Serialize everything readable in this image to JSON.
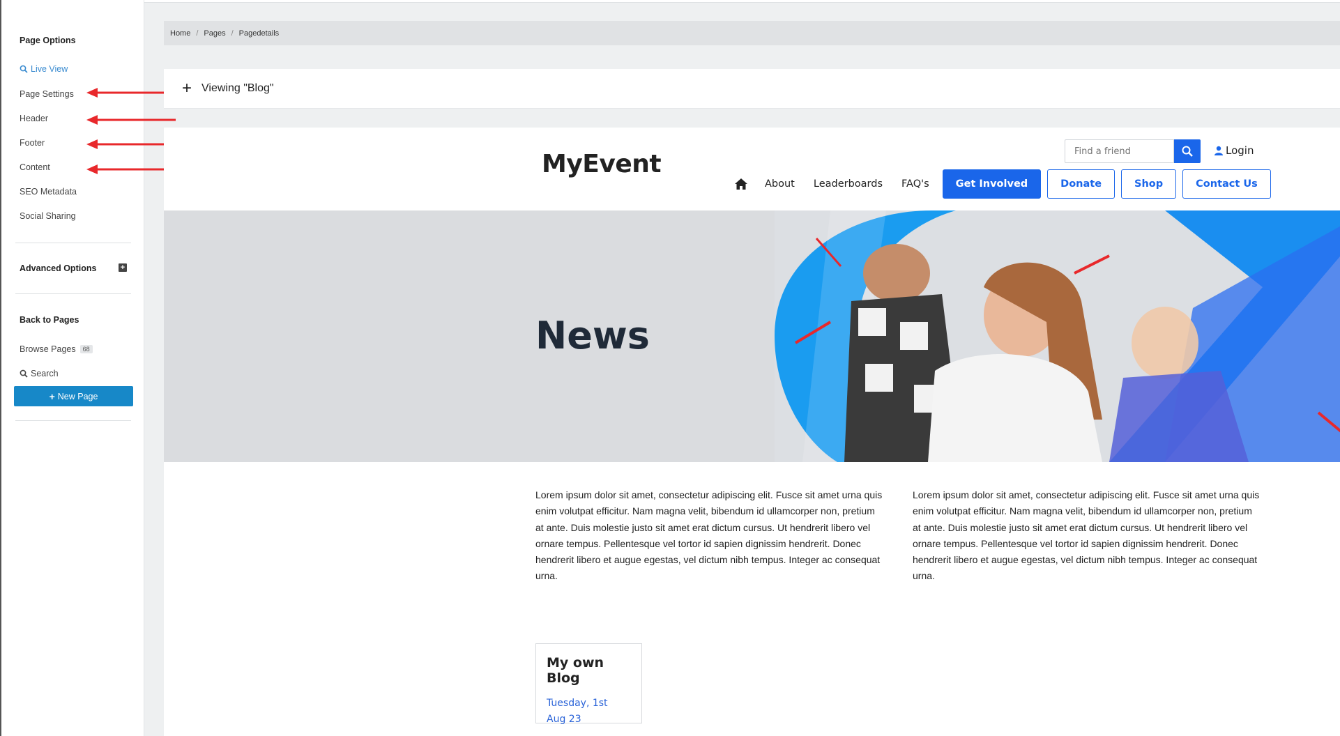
{
  "sidebar": {
    "page_options_title": "Page Options",
    "live_view": "Live View",
    "page_settings": "Page Settings",
    "header": "Header",
    "footer": "Footer",
    "content": "Content",
    "seo_metadata": "SEO Metadata",
    "social_sharing": "Social Sharing",
    "advanced_options": "Advanced Options",
    "back_to_pages": "Back to Pages",
    "browse_pages": "Browse Pages",
    "browse_pages_count": "68",
    "search": "Search",
    "new_page": "New Page"
  },
  "breadcrumb": [
    "Home",
    "Pages",
    "Pagedetails"
  ],
  "viewing": "Viewing \"Blog\"",
  "site": {
    "logo": "MyEvent",
    "search_placeholder": "Find a friend",
    "login": "Login",
    "nav_links": [
      "About",
      "Leaderboards",
      "FAQ's"
    ],
    "nav_buttons": [
      "Get Involved",
      "Donate",
      "Shop",
      "Contact Us"
    ],
    "hero_title": "News",
    "paragraph_1": "Lorem ipsum dolor sit amet, consectetur adipiscing elit. Fusce sit amet urna quis enim volutpat efficitur. Nam magna velit, bibendum id ullamcorper non, pretium at ante. Duis molestie justo sit amet erat dictum cursus. Ut hendrerit libero vel ornare tempus. Pellentesque vel tortor id sapien dignissim hendrerit. Donec hendrerit libero et augue egestas, vel dictum nibh tempus. Integer ac consequat urna.",
    "paragraph_2": "Lorem ipsum dolor sit amet, consectetur adipiscing elit. Fusce sit amet urna quis enim volutpat efficitur. Nam magna velit, bibendum id ullamcorper non, pretium at ante. Duis molestie justo sit amet erat dictum cursus. Ut hendrerit libero vel ornare tempus. Pellentesque vel tortor id sapien dignissim hendrerit. Donec hendrerit libero et augue egestas, vel dictum nibh tempus. Integer ac consequat urna.",
    "blog_card": {
      "title": "My own Blog",
      "date_line_1": "Tuesday, 1st",
      "date_line_2": "Aug 23"
    }
  },
  "colors": {
    "accent_blue": "#1a66ea",
    "sidebar_button": "#1788c8",
    "link_blue": "#3a8bd0",
    "annotation_red": "#e8282b",
    "hero_bg": "#dadcdf"
  }
}
